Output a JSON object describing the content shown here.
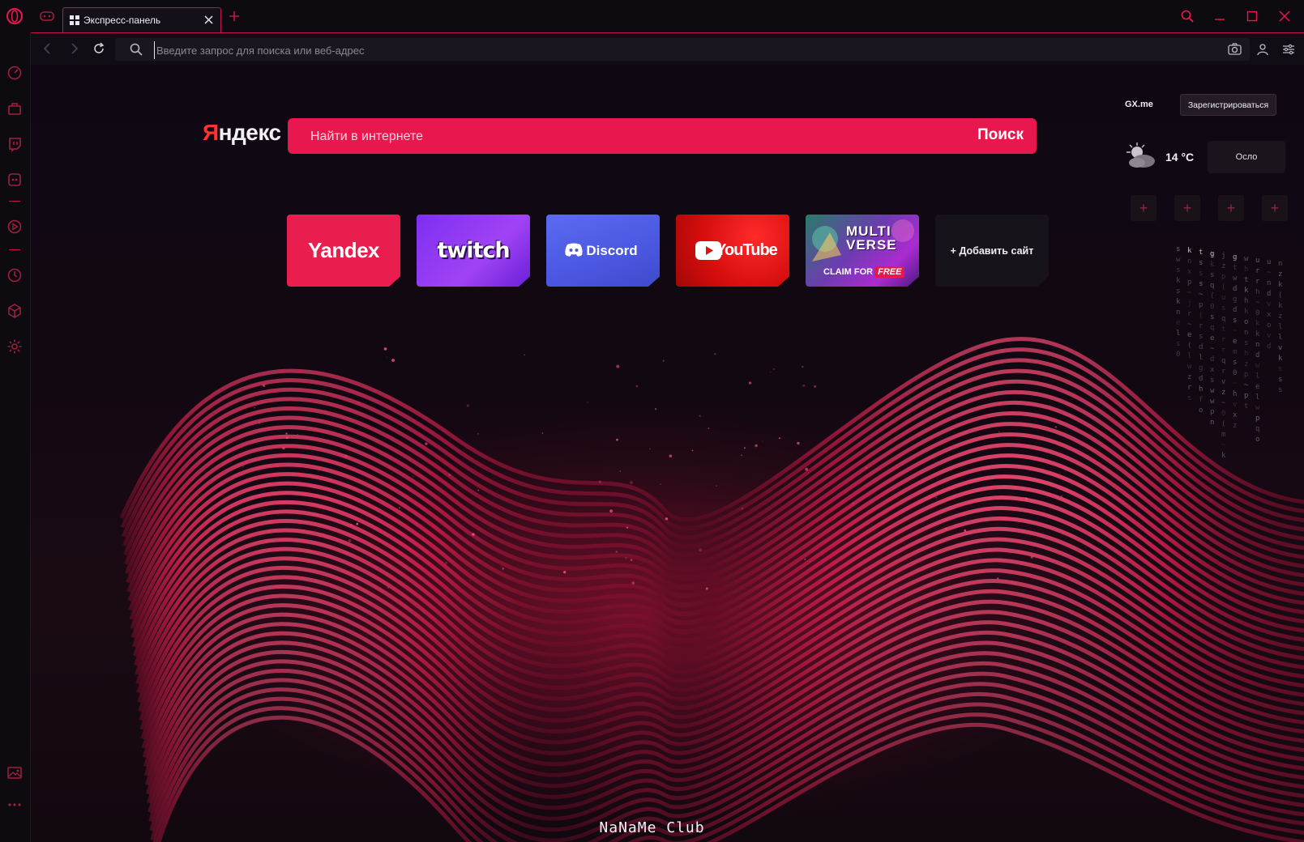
{
  "browser": {
    "tab_title": "Экспресс-панель",
    "address_placeholder": "Введите запрос для поиска или веб-адрес"
  },
  "search": {
    "engine_logo": "Яндекс",
    "placeholder": "Найти в интернете",
    "button_label": "Поиск"
  },
  "speed_dial": {
    "yandex": "Yandex",
    "twitch": "twitch",
    "discord": "Discord",
    "youtube": "YouTube",
    "multiverse_title": "MULTI VERSE",
    "multiverse_claim": "CLAIM FOR",
    "multiverse_free": "FREE",
    "add_site": "+ Добавить сайт"
  },
  "widgets": {
    "gx_label": "GX.me",
    "register_button": "Зарегистрироваться",
    "temperature": "14 °C",
    "city": "Осло"
  },
  "watermark": "NaNaMe Club",
  "colors": {
    "accent": "#e8184f",
    "sidebar_bg": "#0d0a10",
    "panel_bg": "#110d15"
  },
  "icons": {
    "sidebar": [
      "speedometer-icon",
      "bag-icon",
      "twitch-icon",
      "discord-icon",
      "player-icon",
      "history-icon",
      "cube-icon",
      "settings-icon",
      "gallery-icon",
      "more-icon"
    ]
  }
}
